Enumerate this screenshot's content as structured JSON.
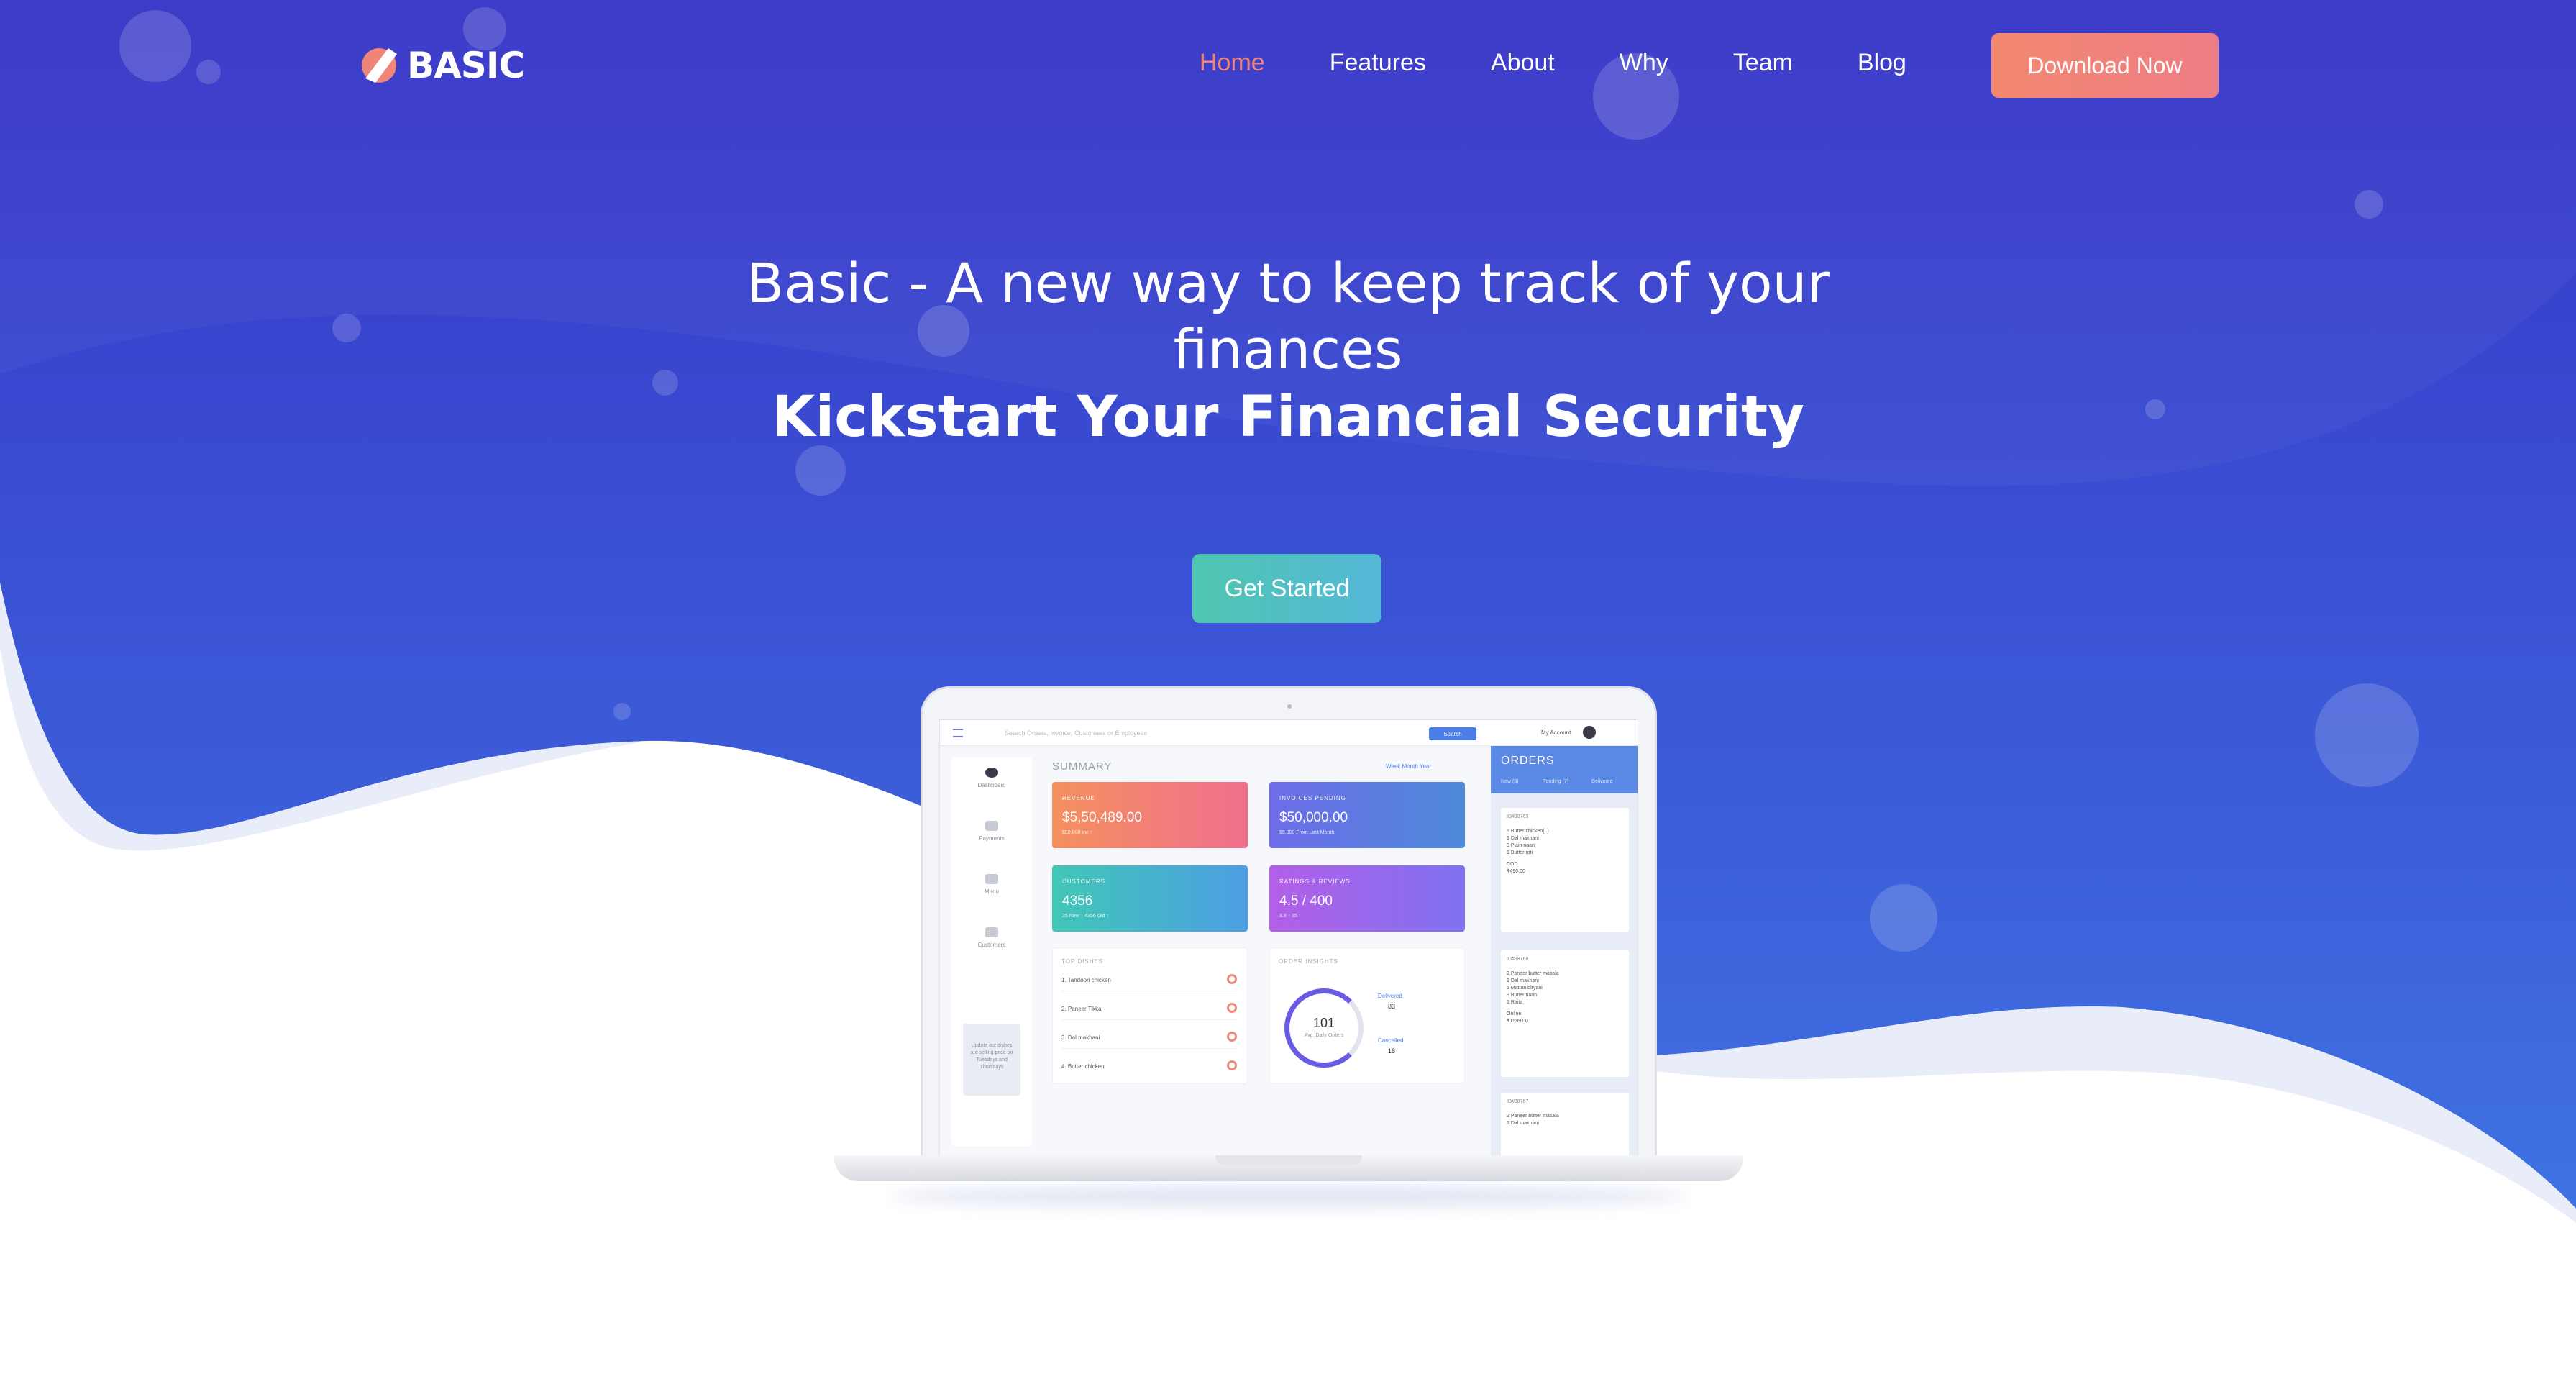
{
  "brand": {
    "name": "BASIC"
  },
  "nav": {
    "items": [
      {
        "label": "Home",
        "active": true
      },
      {
        "label": "Features",
        "active": false
      },
      {
        "label": "About",
        "active": false
      },
      {
        "label": "Why",
        "active": false
      },
      {
        "label": "Team",
        "active": false
      },
      {
        "label": "Blog",
        "active": false
      }
    ],
    "download_label": "Download Now"
  },
  "hero": {
    "title": "Basic - A new way to keep track of your finances",
    "subtitle": "Kickstart Your Financial Security",
    "cta_label": "Get Started"
  },
  "colors": {
    "hero_top": "#3634c7",
    "hero_bottom": "#3f6fe0",
    "accent": "#f08478",
    "cta_teal": "#4ec6b0"
  },
  "dashboard": {
    "search_placeholder": "Search Orders, Invoice, Customers or Employees",
    "search_button": "Search",
    "account_label": "My Account",
    "sidebar": [
      "Dashboard",
      "Payments",
      "Menu",
      "Customers"
    ],
    "sidebar_card": "Update our dishes are selling price on Tuesdays and Thursdays",
    "summary_title": "SUMMARY",
    "periods": "Week   Month   Year",
    "stats": [
      {
        "title": "REVENUE",
        "value": "$5,50,489.00",
        "foot": "$50,000 Inc  ↑"
      },
      {
        "title": "INVOICES PENDING",
        "value": "$50,000.00",
        "foot": "$5,000 From Last Month"
      },
      {
        "title": "CUSTOMERS",
        "value": "4356",
        "foot": "25 New ↑     4356 Old ↑"
      },
      {
        "title": "RATINGS & REVIEWS",
        "value": "4.5 / 400",
        "foot": "3.8 ↑     35 ↑"
      }
    ],
    "top_dishes_title": "TOP DISHES",
    "top_dishes": [
      "1. Tandoori chicken",
      "2. Paneer Tikka",
      "3. Dal makhani",
      "4. Butter chicken"
    ],
    "insights_title": "ORDER INSIGHTS",
    "insights_total": "101",
    "insights_total_label": "Avg. Daily Orders",
    "delivered_label": "Delivered",
    "delivered_value": "83",
    "cancelled_label": "Cancelled",
    "cancelled_value": "18",
    "orders_title": "ORDERS",
    "order_tabs": [
      "New (3)",
      "Pending (7)",
      "Delivered"
    ],
    "order_cards": [
      {
        "id": "ID#38769",
        "items": "1 Butter chicken(L)\n1 Dal makhani\n3 Plain naan\n1 Butter roti",
        "payment": "COD",
        "amount": "₹490.00"
      },
      {
        "id": "ID#38768",
        "items": "2 Paneer butter masala\n1 Dal makhani\n1 Matton biryani\n3 Butter naan\n1 Raita",
        "payment": "Online",
        "amount": "₹1599.00"
      },
      {
        "id": "ID#38767",
        "items": "2 Paneer butter masala\n1 Dal makhani",
        "payment": "",
        "amount": ""
      }
    ]
  }
}
